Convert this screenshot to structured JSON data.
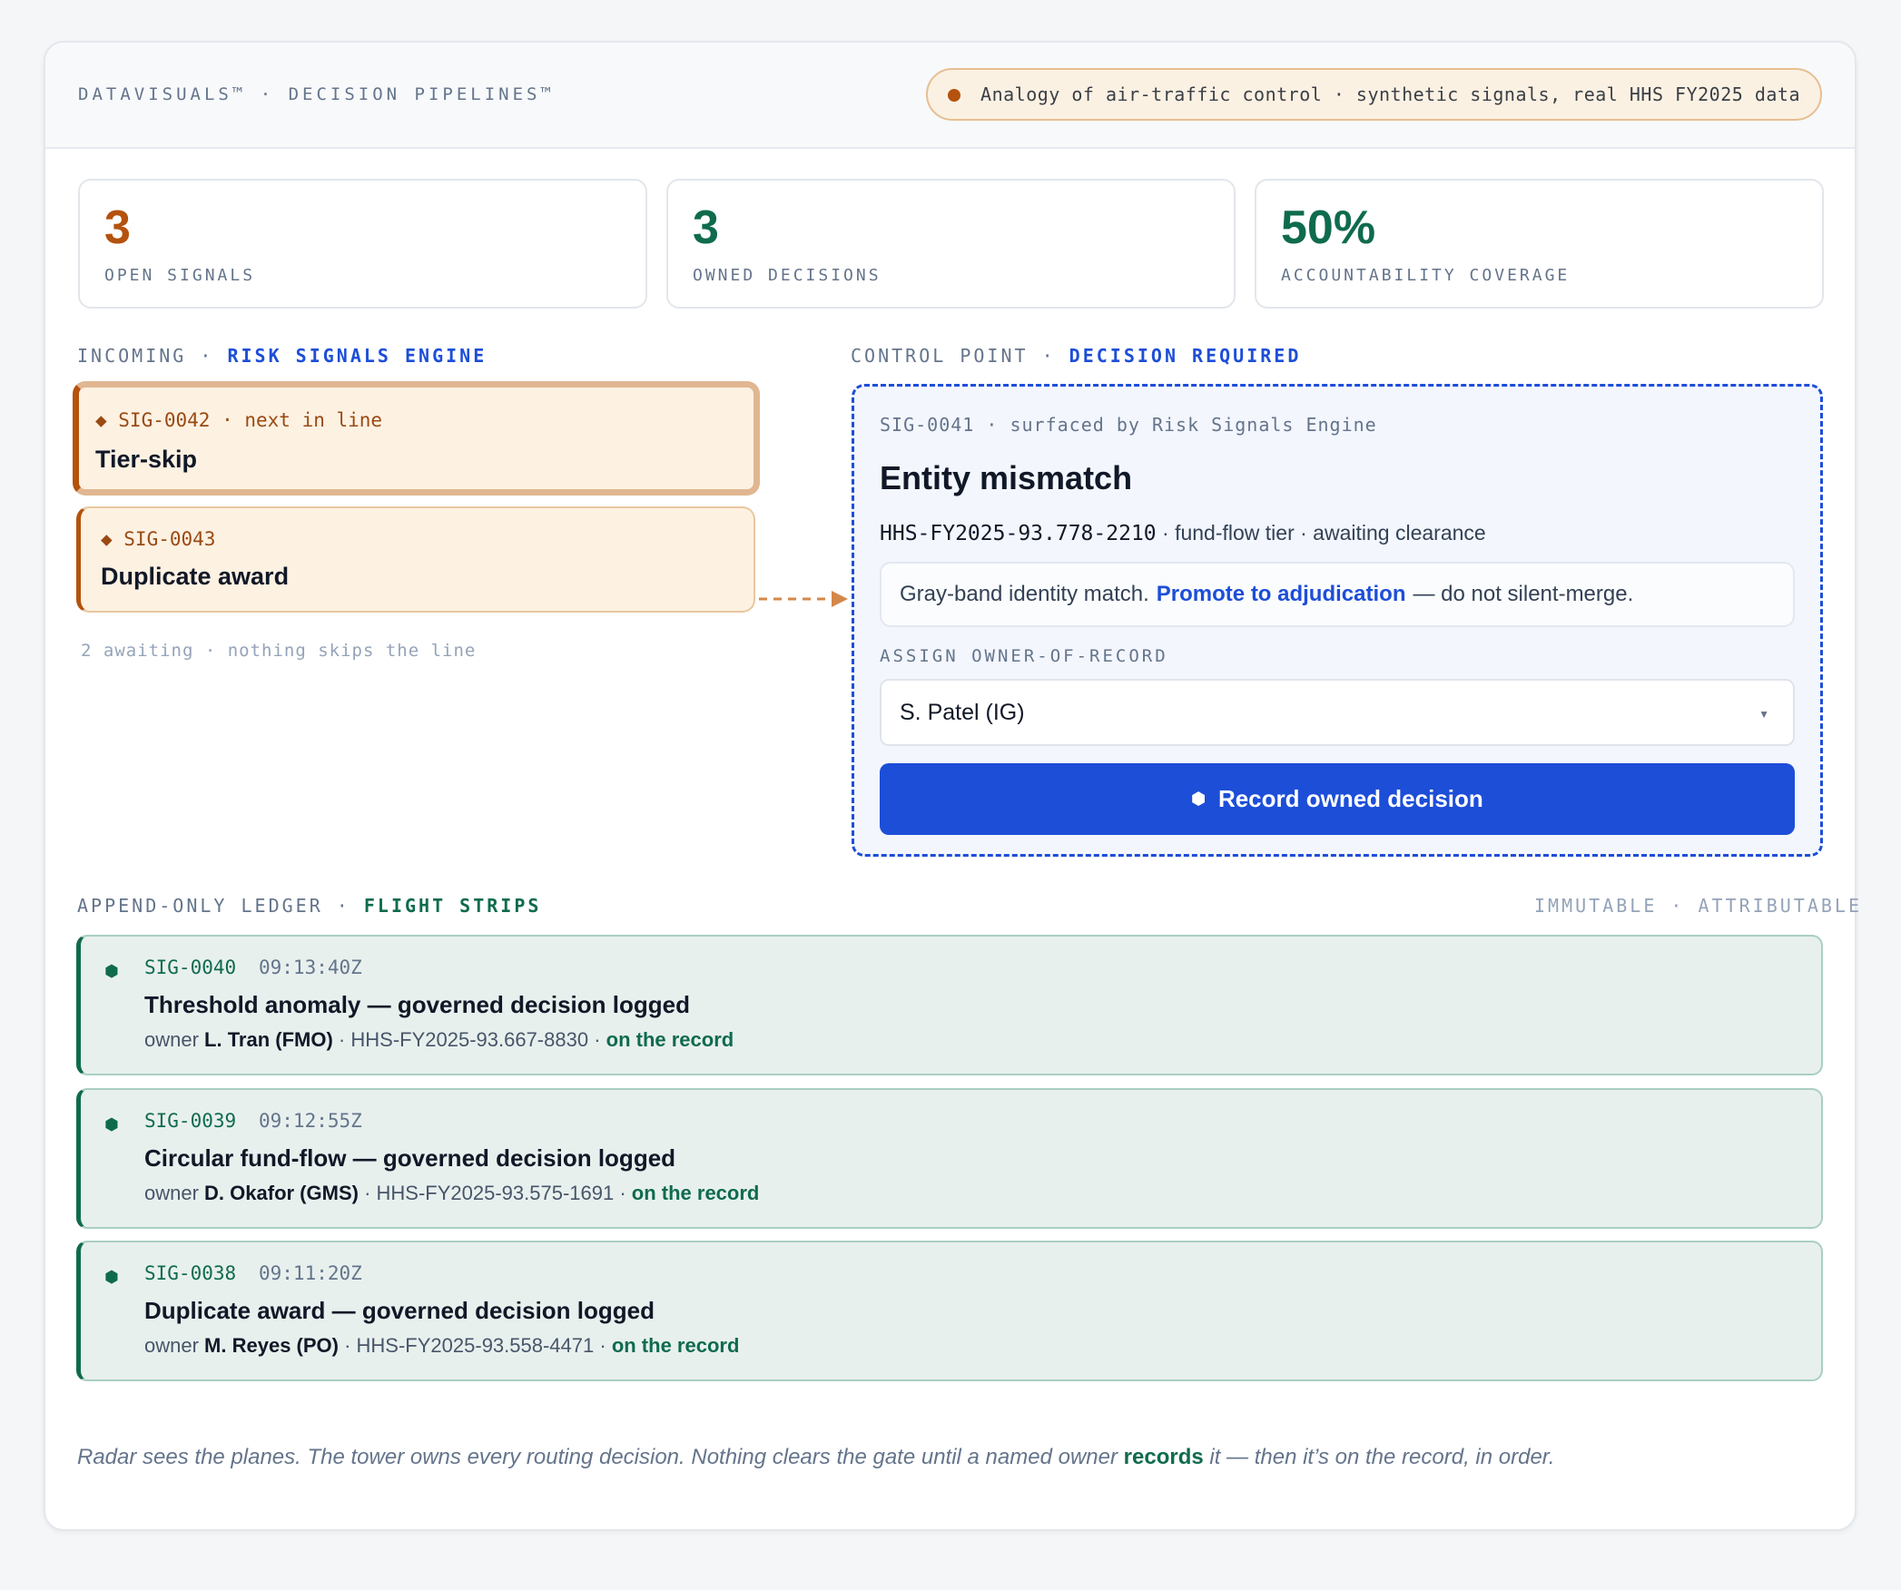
{
  "header": {
    "brand": "DATAVISUALS™ · DECISION PIPELINES™",
    "pill": "Analogy of air-traffic control · synthetic signals, real HHS FY2025 data"
  },
  "stats": [
    {
      "value": "3",
      "label": "OPEN SIGNALS",
      "color": "#b4520e"
    },
    {
      "value": "3",
      "label": "OWNED DECISIONS",
      "color": "#0f6b4e"
    },
    {
      "value": "50%",
      "label": "ACCOUNTABILITY COVERAGE",
      "color": "#0f6b4e"
    }
  ],
  "incoming": {
    "label_prefix": "INCOMING · ",
    "label_emph": "RISK SIGNALS ENGINE",
    "signals": [
      {
        "id": "◆ SIG-0042 · next in line",
        "name": "Tier-skip"
      },
      {
        "id": "◆ SIG-0043",
        "name": "Duplicate award"
      }
    ],
    "awaiting": "2 awaiting · nothing skips the line"
  },
  "control": {
    "label_prefix": "CONTROL POINT · ",
    "label_emph": "DECISION REQUIRED",
    "signal_ref": "SIG-0041 · surfaced by Risk Signals Engine",
    "title": "Entity mismatch",
    "award_id": "HHS-FY2025-93.778-2210",
    "meta_rest": " · fund-flow tier · awaiting clearance",
    "note_pre": "Gray-band identity match.",
    "note_link": "Promote to adjudication",
    "note_post": "— do not silent-merge.",
    "assign_label": "ASSIGN OWNER-OF-RECORD",
    "owner_selected": "S. Patel (IG)",
    "record_button": "Record owned decision"
  },
  "ledger": {
    "label_prefix": "APPEND-ONLY LEDGER · ",
    "label_emph": "FLIGHT STRIPS",
    "right_label": "IMMUTABLE · ATTRIBUTABLE",
    "owner_prefix": "owner ",
    "on_record": "on the record",
    "strips": [
      {
        "id": "SIG-0040",
        "time": "09:13:40Z",
        "title": "Threshold anomaly — governed decision logged",
        "owner": "L. Tran (FMO)",
        "award": " · HHS-FY2025-93.667-8830 · "
      },
      {
        "id": "SIG-0039",
        "time": "09:12:55Z",
        "title": "Circular fund-flow — governed decision logged",
        "owner": "D. Okafor (GMS)",
        "award": " · HHS-FY2025-93.575-1691 · "
      },
      {
        "id": "SIG-0038",
        "time": "09:11:20Z",
        "title": "Duplicate award — governed decision logged",
        "owner": "M. Reyes (PO)",
        "award": " · HHS-FY2025-93.558-4471 · "
      }
    ]
  },
  "footer": {
    "pre": "Radar sees the planes. The tower owns every routing decision. Nothing clears the gate until a named owner ",
    "keyword": "records",
    "post": " it — then it’s on the record, in order."
  },
  "icons": {
    "pill_dot": "status-dot-icon",
    "signal_marker": "diamond-icon",
    "record": "hexagon-icon",
    "strip_marker": "hexagon-icon",
    "select_caret": "chevron-down-icon"
  }
}
